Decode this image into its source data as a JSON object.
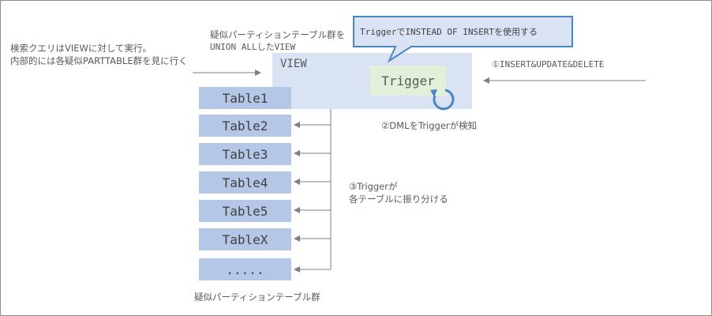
{
  "note_view_query": [
    "検索クエリはVIEWに対して実行。",
    "内部的には各疑似PARTTABLE群を見に行く"
  ],
  "note_union": [
    "疑似パーティションテーブル群を",
    "UNION ALLしたVIEW"
  ],
  "view_label": "VIEW",
  "trigger_label": "Trigger",
  "callout": "TriggerでINSTEAD OF INSERTを使用する",
  "step1": "①INSERT&UPDATE&DELETE",
  "step2": "②DMLをTriggerが検知",
  "step3": [
    "③Triggerが",
    "各テーブルに振り分ける"
  ],
  "tables": [
    "Table1",
    "Table2",
    "Table3",
    "Table4",
    "Table5",
    "TableX",
    "....."
  ],
  "table_group_caption": "疑似パーティションテーブル群",
  "colors": {
    "table_fill": "#b4c7e7",
    "view_fill": "#dae3f3",
    "trigger_fill": "#e2f0d9",
    "callout_border": "#4a86c5",
    "callout_fill": "#dae3f3",
    "arrow": "#7f7f7f",
    "cycle_icon": "#4a86c5"
  }
}
